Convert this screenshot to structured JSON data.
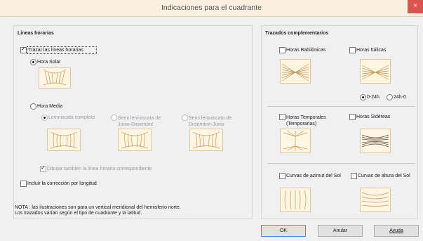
{
  "window": {
    "title": "Indicaciones para el cuadrante",
    "close_glyph": "×"
  },
  "left": {
    "header": "Líneas horarias",
    "trace_lines": "Trazar las líneas horarias",
    "solar_time": "Hora Solar",
    "mean_time": "Hora Media",
    "lemniscate_full": "Lemniscata completa",
    "lemniscate_jun_dec": "Semi lemniscata de Junio-Diciembre",
    "lemniscate_dec_jun": "Semi lemniscata de Diciembre-Junio",
    "draw_also": "Dibujar también la línea horaria correspondiente",
    "longitude_correction": "Incluir la corrección por longitud"
  },
  "note": {
    "line1": "NOTA : las ilustraciones son para un vertical meridional del hemisferio norte.",
    "line2": "Los trazados varían según el tipo de cuadrante y la latitud."
  },
  "right": {
    "header": "Trazados complementarios",
    "babylonian": "Horas Babilónicas",
    "italic": "Horas Itálicas",
    "r_0_24": "0-24h",
    "r_24_0": "24h-0",
    "temporal": "Horas Temporales (Temporarias)",
    "sidereal": "Horas Sidéreas",
    "azimuth": "Curvas de azimut del Sol",
    "altitude": "Curvas de altura del Sol"
  },
  "buttons": {
    "ok": "OK",
    "cancel": "Anular",
    "help": "Ayuda"
  },
  "colors": {
    "thumb_fill": "#fff5e1",
    "thumb_line": "#c09a5a"
  }
}
